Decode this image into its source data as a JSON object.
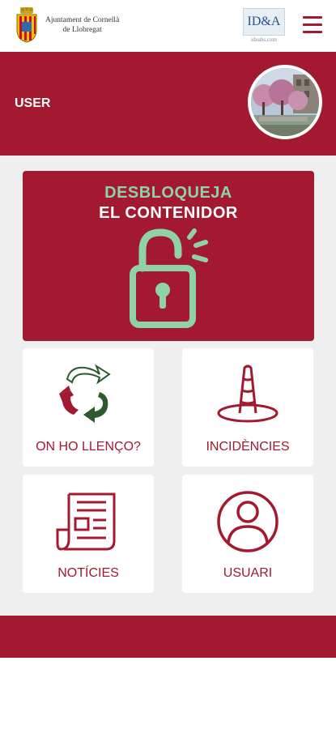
{
  "header": {
    "ajuntament_line1": "Ajuntament de Cornellà",
    "ajuntament_line2": "de Llobregat",
    "partner_logo_text": "ID&A",
    "partner_logo_sub": "ideabs.com",
    "menu_icon": "hamburger-icon"
  },
  "profile": {
    "user_label": "USER",
    "avatar_icon": "avatar-photo"
  },
  "unlock": {
    "title_line1": "DESBLOQUEJA",
    "title_line2": "EL CONTENIDOR",
    "icon": "unlocked-padlock-icon"
  },
  "tiles": [
    {
      "label": "ON HO LLENÇO?",
      "icon": "recycle-icon"
    },
    {
      "label": "INCIDÈNCIES",
      "icon": "traffic-cone-icon"
    },
    {
      "label": "NOTÍCIES",
      "icon": "newspaper-icon"
    },
    {
      "label": "USUARI",
      "icon": "user-circle-icon"
    }
  ],
  "colors": {
    "brand_red": "#a3192f",
    "mint_green": "#8fd3a4",
    "dark_green": "#2e5a2f",
    "background_gray": "#efefef"
  }
}
